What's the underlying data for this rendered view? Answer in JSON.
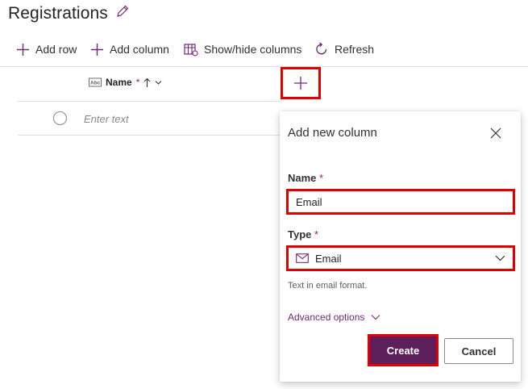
{
  "page": {
    "title": "Registrations"
  },
  "toolbar": {
    "add_row": "Add row",
    "add_column": "Add column",
    "show_hide_columns": "Show/hide columns",
    "refresh": "Refresh"
  },
  "grid": {
    "column_name": "Name",
    "required_mark": "*",
    "row_placeholder": "Enter text"
  },
  "panel": {
    "title": "Add new column",
    "name_label": "Name",
    "name_value": "Email",
    "type_label": "Type",
    "type_value": "Email",
    "required_mark": "*",
    "helper_text": "Text in email format.",
    "advanced_options": "Advanced options",
    "create_label": "Create",
    "cancel_label": "Cancel"
  },
  "colors": {
    "accent": "#742774",
    "primary_button": "#5c1f5c",
    "highlight": "#e00000"
  }
}
